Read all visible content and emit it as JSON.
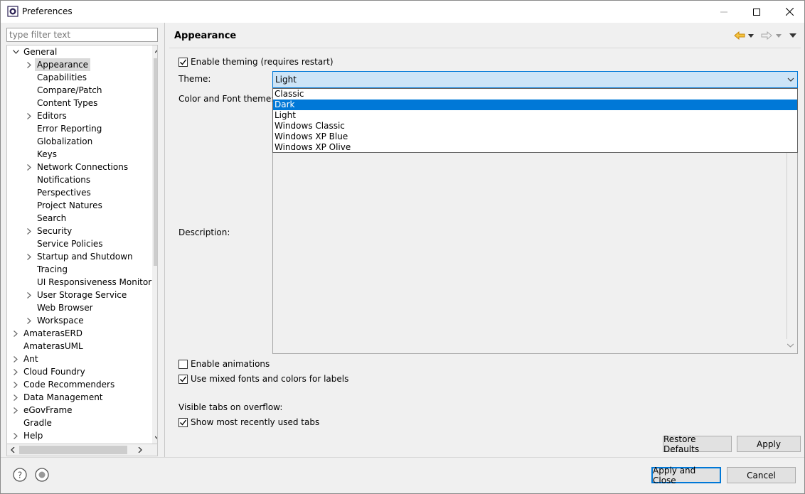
{
  "window": {
    "title": "Preferences"
  },
  "filter": {
    "placeholder": "type filter text"
  },
  "tree": {
    "items": [
      {
        "label": "General",
        "expanded": true,
        "level": 0
      },
      {
        "label": "Appearance",
        "expanded": false,
        "level": 1,
        "selected": true
      },
      {
        "label": "Capabilities",
        "level": 1
      },
      {
        "label": "Compare/Patch",
        "level": 1
      },
      {
        "label": "Content Types",
        "level": 1
      },
      {
        "label": "Editors",
        "expanded": false,
        "level": 1
      },
      {
        "label": "Error Reporting",
        "level": 1
      },
      {
        "label": "Globalization",
        "level": 1
      },
      {
        "label": "Keys",
        "level": 1
      },
      {
        "label": "Network Connections",
        "expanded": false,
        "level": 1
      },
      {
        "label": "Notifications",
        "level": 1
      },
      {
        "label": "Perspectives",
        "level": 1
      },
      {
        "label": "Project Natures",
        "level": 1
      },
      {
        "label": "Search",
        "level": 1
      },
      {
        "label": "Security",
        "expanded": false,
        "level": 1
      },
      {
        "label": "Service Policies",
        "level": 1
      },
      {
        "label": "Startup and Shutdown",
        "expanded": false,
        "level": 1
      },
      {
        "label": "Tracing",
        "level": 1
      },
      {
        "label": "UI Responsiveness Monitorin",
        "level": 1
      },
      {
        "label": "User Storage Service",
        "expanded": false,
        "level": 1
      },
      {
        "label": "Web Browser",
        "level": 1
      },
      {
        "label": "Workspace",
        "expanded": false,
        "level": 1
      },
      {
        "label": "AmaterasERD",
        "expanded": false,
        "level": 0
      },
      {
        "label": "AmaterasUML",
        "level": 0
      },
      {
        "label": "Ant",
        "expanded": false,
        "level": 0
      },
      {
        "label": "Cloud Foundry",
        "expanded": false,
        "level": 0
      },
      {
        "label": "Code Recommenders",
        "expanded": false,
        "level": 0
      },
      {
        "label": "Data Management",
        "expanded": false,
        "level": 0
      },
      {
        "label": "eGovFrame",
        "expanded": false,
        "level": 0
      },
      {
        "label": "Gradle",
        "level": 0
      },
      {
        "label": "Help",
        "expanded": false,
        "level": 0
      }
    ]
  },
  "page": {
    "title": "Appearance",
    "enable_theming": {
      "label": "Enable theming (requires restart)",
      "checked": true
    },
    "theme_label": "Theme:",
    "theme_value": "Light",
    "theme_options": [
      "Classic",
      "Dark",
      "Light",
      "Windows Classic",
      "Windows XP Blue",
      "Windows XP Olive"
    ],
    "theme_highlighted": "Dark",
    "color_font_label": "Color and Font theme:",
    "description_label": "Description:",
    "enable_animations": {
      "label": "Enable animations",
      "checked": false
    },
    "mixed_fonts": {
      "label": "Use mixed fonts and colors for labels",
      "checked": true
    },
    "visible_tabs_label": "Visible tabs on overflow:",
    "show_recent_tabs": {
      "label": "Show most recently used tabs",
      "checked": true
    }
  },
  "buttons": {
    "restore_defaults": "Restore Defaults",
    "apply": "Apply",
    "apply_and_close": "Apply and Close",
    "cancel": "Cancel"
  },
  "colors": {
    "accent": "#0078d7",
    "selection_bg": "#d9d9d9",
    "combo_bg": "#cce4f7",
    "nav_back": "#e8a317"
  }
}
